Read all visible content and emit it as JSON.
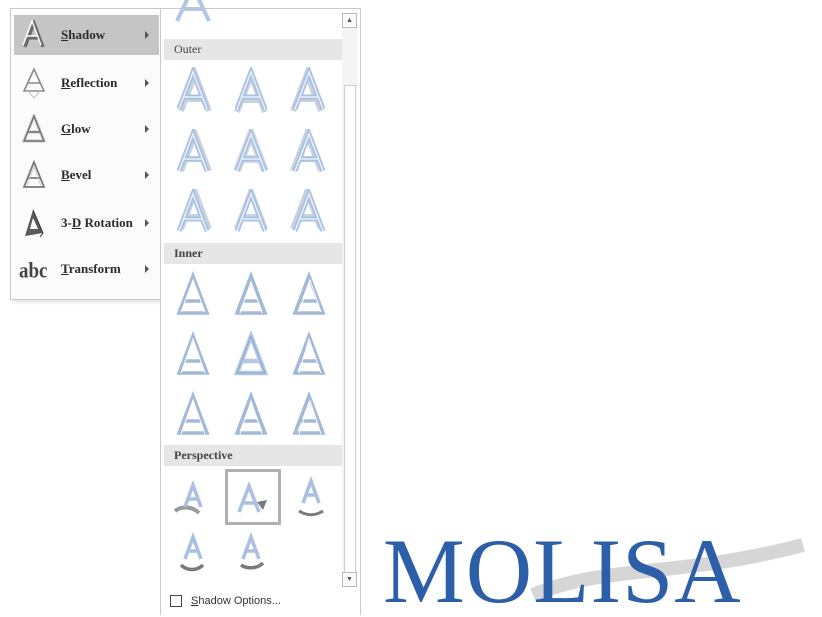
{
  "menu": {
    "items": [
      {
        "key": "S",
        "rest": "hadow",
        "icon": "shadow-a-icon",
        "active": true
      },
      {
        "key": "R",
        "rest": "eflection",
        "icon": "reflection-a-icon",
        "active": false
      },
      {
        "key": "G",
        "rest": "low",
        "icon": "glow-a-icon",
        "active": false
      },
      {
        "key": "B",
        "rest": "evel",
        "icon": "bevel-a-icon",
        "active": false
      },
      {
        "pre": "3-",
        "key": "D",
        "rest": " Rotation",
        "icon": "rotation-3d-a-icon",
        "active": false
      },
      {
        "key": "T",
        "rest": "ransform",
        "icon": "transform-abc-icon",
        "active": false
      }
    ]
  },
  "gallery": {
    "sections": {
      "outer": "Outer",
      "inner": "Inner",
      "perspective": "Perspective"
    },
    "options_pre": "",
    "options_key": "S",
    "options_rest": "hadow Options..."
  },
  "colors": {
    "accent_blue": "#2d5ea8",
    "active_bg": "#c5c5c5",
    "header_bg": "#e6e6e6"
  },
  "watermark": {
    "text": "MOLISA"
  }
}
